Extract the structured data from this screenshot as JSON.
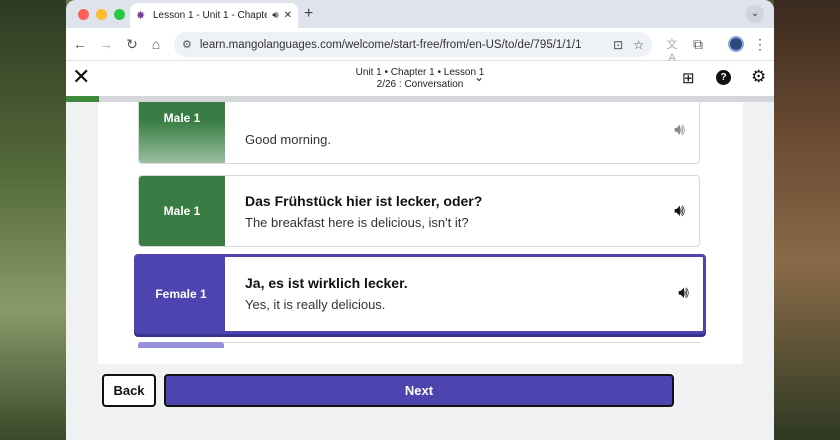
{
  "browser": {
    "tab_title": "Lesson 1 - Unit 1 - Chapter",
    "tab_favicon": "mango-logo-icon",
    "url_site_icon": "site-info-icon",
    "url": "learn.mangolanguages.com/welcome/start-free/from/en-US/to/de/795/1/1/1"
  },
  "app": {
    "breadcrumb": "Unit 1 • Chapter 1 • Lesson 1",
    "step": "2/26 : Conversation",
    "progress": 0.047,
    "accent": "#4e44b0",
    "male_color": "#3a7d44"
  },
  "cards": [
    {
      "speaker": "Male 1",
      "de": "",
      "en": "Good morning."
    },
    {
      "speaker": "Male 1",
      "de": "Das Frühstück hier ist lecker, oder?",
      "en": "The breakfast here is delicious, isn't it?"
    },
    {
      "speaker": "Female 1",
      "de": "Ja, es ist wirklich lecker.",
      "en": "Yes, it is really delicious."
    }
  ],
  "buttons": {
    "back": "Back",
    "next": "Next"
  }
}
